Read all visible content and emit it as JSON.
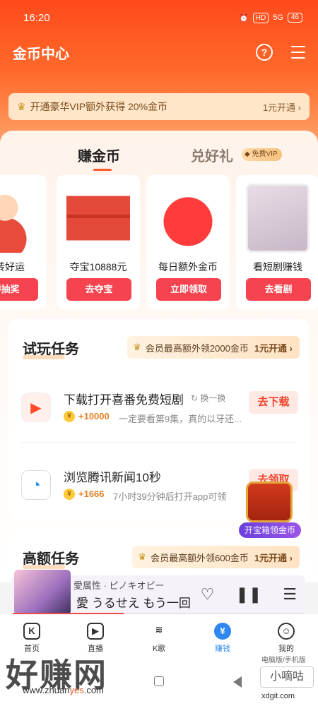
{
  "status_bar": {
    "time": "16:20",
    "hd": "HD",
    "network": "5G",
    "battery": "46"
  },
  "header": {
    "title": "金币中心"
  },
  "vip_banner": {
    "text": "开通豪华VIP额外获得 20%金币",
    "cta": "1元开通 ›"
  },
  "tabs": {
    "earn": "赚金币",
    "gift": "兑好礼",
    "gift_tag": "免费VIP"
  },
  "carousel": [
    {
      "label": "神转好运",
      "button": "即抽奖"
    },
    {
      "label": "夺宝10888元",
      "button": "去夺宝"
    },
    {
      "label": "每日额外金币",
      "button": "立即领取"
    },
    {
      "label": "看短剧赚钱",
      "button": "去看剧"
    }
  ],
  "trial_section": {
    "title": "试玩任务",
    "promo": "会员最高额外领2000金币",
    "promo_cta": "1元开通 ›",
    "tasks": [
      {
        "name": "下载打开喜番免费短剧",
        "swap": "↻ 换一换",
        "reward": "+10000",
        "desc": "一定要看第9集，真的以牙还...",
        "button": "去下载"
      },
      {
        "name": "浏览腾讯新闻10秒",
        "reward": "+1666",
        "desc": "7小时39分钟后打开app可领",
        "button": "去领取"
      }
    ]
  },
  "high_section": {
    "title": "高额任务",
    "promo": "会员最高额外领600金币",
    "promo_cta": "1元开通 ›"
  },
  "float_chest": {
    "label": "开宝箱领金币"
  },
  "player": {
    "meta": "愛属性 · ピノキオピー",
    "lyric": "愛 うるせえ もう一回",
    "progress": 0.38
  },
  "bottom_nav": [
    {
      "icon": "K",
      "label": "首页"
    },
    {
      "icon": "▶",
      "label": "直播"
    },
    {
      "icon": "≋",
      "label": "K歌"
    },
    {
      "icon": "¥",
      "label": "赚钱"
    },
    {
      "icon": "☺",
      "label": "我的"
    }
  ],
  "watermark": {
    "big": "好赚网",
    "url_prefix": "www.zhuan",
    "url_highlight": "yes",
    "url_suffix": ".com",
    "right_top": "电脑版/手机版",
    "right_box": "小嘀咕",
    "right_bottom": "xdgit.com"
  },
  "colors": {
    "accent": "#ff4a1c",
    "button_red": "#f5434f",
    "nav_active": "#2f87f2"
  }
}
